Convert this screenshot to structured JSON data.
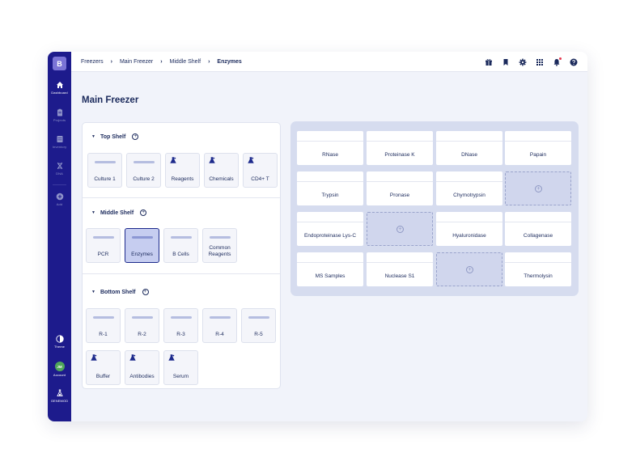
{
  "app": {
    "logo_letter": "B",
    "brand": "GENEMOD"
  },
  "sidebar": {
    "items": [
      {
        "label": "Dashboard",
        "icon": "home-icon"
      },
      {
        "label": "Projects",
        "icon": "clipboard-icon"
      },
      {
        "label": "Inventory",
        "icon": "inventory-icon"
      },
      {
        "label": "DNA",
        "icon": "dna-icon"
      },
      {
        "label": "Add",
        "icon": "add-icon"
      }
    ],
    "bottom": [
      {
        "label": "Theme",
        "icon": "theme-icon"
      },
      {
        "label": "Account",
        "avatar": "JM"
      }
    ]
  },
  "breadcrumb": [
    "Freezers",
    "Main Freezer",
    "Middle Shelf",
    "Enzymes"
  ],
  "breadcrumb_sep": "›",
  "topbar_icons": [
    "gift-icon",
    "bookmark-icon",
    "gear-icon",
    "apps-grid-icon",
    "bell-icon",
    "help-icon"
  ],
  "page": {
    "title": "Main Freezer"
  },
  "shelves": [
    {
      "name": "Top Shelf",
      "add": "+",
      "boxes": [
        {
          "name": "Culture 1",
          "kind": "bar"
        },
        {
          "name": "Culture 2",
          "kind": "bar"
        },
        {
          "name": "Reagents",
          "kind": "flask"
        },
        {
          "name": "Chemicals",
          "kind": "flask"
        },
        {
          "name": "CD4+ T",
          "kind": "flask"
        }
      ]
    },
    {
      "name": "Middle Shelf",
      "add": "+",
      "boxes": [
        {
          "name": "PCR",
          "kind": "bar"
        },
        {
          "name": "Enzymes",
          "kind": "bar",
          "selected": true
        },
        {
          "name": "B Cells",
          "kind": "bar"
        },
        {
          "name": "Common",
          "name2": "Reagents",
          "kind": "bar"
        }
      ]
    },
    {
      "name": "Bottom Shelf",
      "add": "+",
      "boxes": [
        {
          "name": "R-1",
          "kind": "bar"
        },
        {
          "name": "R-2",
          "kind": "bar"
        },
        {
          "name": "R-3",
          "kind": "bar"
        },
        {
          "name": "R-4",
          "kind": "bar"
        },
        {
          "name": "R-5",
          "kind": "bar"
        },
        {
          "name": "Buffer",
          "kind": "flask"
        },
        {
          "name": "Antibodies",
          "kind": "flask"
        },
        {
          "name": "Serum",
          "kind": "flask"
        }
      ]
    }
  ],
  "enzymes_grid": [
    [
      "RNase",
      "Proteinase K",
      "DNase",
      "Papain"
    ],
    [
      "Trypsin",
      "Pronase",
      "Chymotrypsin",
      ""
    ],
    [
      "Endoproteinase Lys-C",
      "",
      "Hyaluronidase",
      "Collagenase"
    ],
    [
      "MS Samples",
      "Nuclease S1",
      "",
      "Thermolysin"
    ]
  ],
  "empty_cell_symbol": "+",
  "colors": {
    "sidebar": "#1d1b8c",
    "accent": "#7b74d6",
    "selected_box": "#c6cdf0",
    "grid_bg": "#d6dcef"
  }
}
